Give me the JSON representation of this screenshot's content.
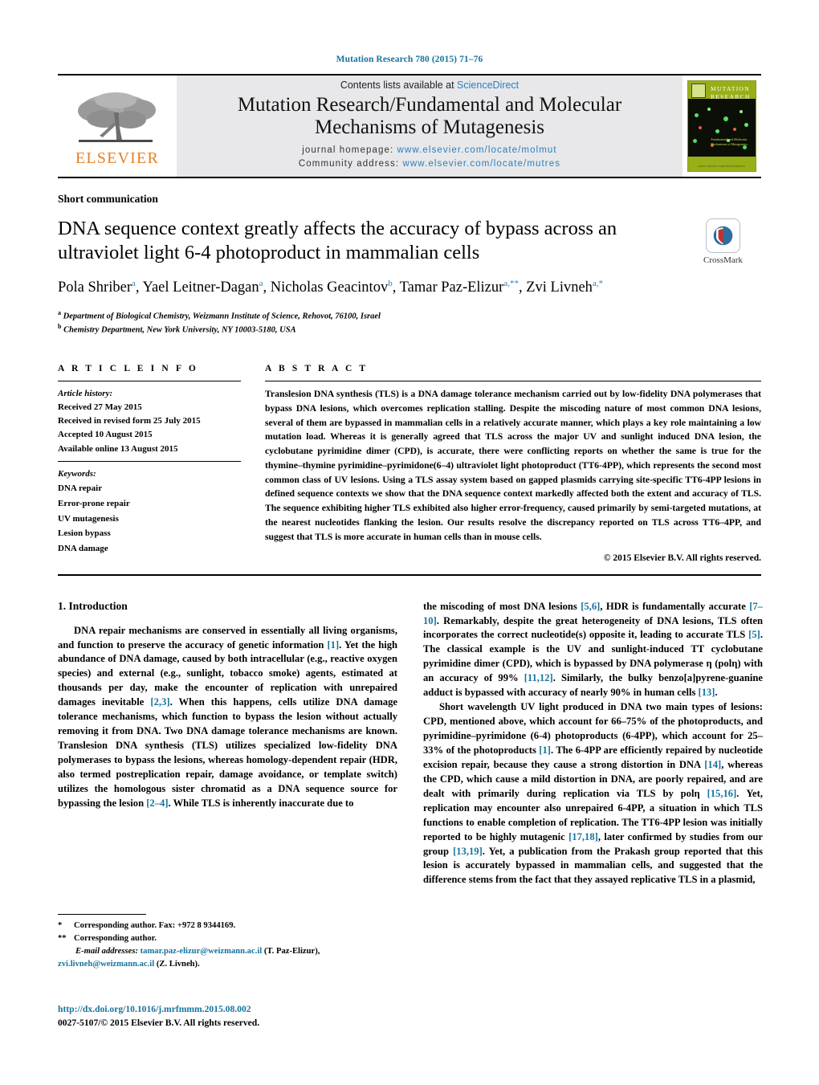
{
  "running_head": "Mutation Research 780 (2015) 71–76",
  "masthead": {
    "publisher_name": "ELSEVIER",
    "contents_prefix": "Contents lists available at ",
    "contents_link": "ScienceDirect",
    "journal_title_line1": "Mutation Research/Fundamental and Molecular",
    "journal_title_line2": "Mechanisms of Mutagenesis",
    "homepage_label": "journal homepage: ",
    "homepage_url": "www.elsevier.com/locate/molmut",
    "community_label": "Community address: ",
    "community_url": "www.elsevier.com/locate/mutres",
    "cover_title_line1": "MUTATION",
    "cover_title_line2": "RESEARCH",
    "cover_subtitle": "Fundamental and Molecular Mechanisms of Mutagenesis",
    "cover_footer": "www.elsevier.com/locate/mutres"
  },
  "article": {
    "type_label": "Short communication",
    "title_line1": "DNA sequence context greatly affects the accuracy of bypass across an",
    "title_line2": "ultraviolet light 6-4 photoproduct in mammalian cells",
    "crossmark_label": "CrossMark",
    "authors_line1": "Pola Shriber",
    "authors_marks": [
      {
        "name": "Pola Shriber",
        "sup": "a",
        "sep": ", "
      },
      {
        "name": "Yael Leitner-Dagan",
        "sup": "a",
        "sep": ", "
      },
      {
        "name": "Nicholas Geacintov",
        "sup": "b",
        "sep": ", "
      },
      {
        "name": "Tamar Paz-Elizur",
        "sup": "a,**",
        "sep": ","
      },
      {
        "name": "Zvi Livneh",
        "sup": "a,*",
        "sep": ""
      }
    ],
    "affiliations": [
      {
        "mark": "a",
        "text": "Department of Biological Chemistry, Weizmann Institute of Science, Rehovot, 76100, Israel"
      },
      {
        "mark": "b",
        "text": "Chemistry Department, New York University, NY 10003-5180, USA"
      }
    ]
  },
  "article_info": {
    "heading": "A R T I C L E    I N F O",
    "history_label": "Article history:",
    "history": [
      "Received 27 May 2015",
      "Received in revised form 25 July 2015",
      "Accepted 10 August 2015",
      "Available online 13 August 2015"
    ],
    "keywords_label": "Keywords:",
    "keywords": [
      "DNA repair",
      "Error-prone repair",
      "UV mutagenesis",
      "Lesion bypass",
      "DNA damage"
    ]
  },
  "abstract": {
    "heading": "A B S T R A C T",
    "text": "Translesion DNA synthesis (TLS) is a DNA damage tolerance mechanism carried out by low-fidelity DNA polymerases that bypass DNA lesions, which overcomes replication stalling. Despite the miscoding nature of most common DNA lesions, several of them are bypassed in mammalian cells in a relatively accurate manner, which plays a key role maintaining a low mutation load. Whereas it is generally agreed that TLS across the major UV and sunlight induced DNA lesion, the cyclobutane pyrimidine dimer (CPD), is accurate, there were conflicting reports on whether the same is true for the thymine–thymine pyrimidine–pyrimidone(6–4) ultraviolet light photoproduct (TT6-4PP), which represents the second most common class of UV lesions. Using a TLS assay system based on gapped plasmids carrying site-specific TT6-4PP lesions in defined sequence contexts we show that the DNA sequence context markedly affected both the extent and accuracy of TLS. The sequence exhibiting higher TLS exhibited also higher error-frequency, caused primarily by semi-targeted mutations, at the nearest nucleotides flanking the lesion. Our results resolve the discrepancy reported on TLS across TT6–4PP, and suggest that TLS is more accurate in human cells than in mouse cells.",
    "copyright": "© 2015 Elsevier B.V. All rights reserved."
  },
  "introduction": {
    "heading": "1.  Introduction",
    "left_paragraph_1_a": "DNA repair mechanisms are conserved in essentially all living organisms, and function to preserve the accuracy of genetic information ",
    "left_ref_1": "[1]",
    "left_paragraph_1_b": ". Yet the high abundance of DNA damage, caused by both intracellular (e.g., reactive oxygen species) and external (e.g., sunlight, tobacco smoke) agents, estimated at thousands per day, make the encounter of replication with unrepaired damages inevitable ",
    "left_ref_2": "[2,3]",
    "left_paragraph_1_c": ". When this happens, cells utilize DNA damage tolerance mechanisms, which function to bypass the lesion without actually removing it from DNA. Two DNA damage tolerance mechanisms are known. Translesion DNA synthesis (TLS) utilizes specialized low-fidelity DNA polymerases to bypass the lesions, whereas homology-dependent repair (HDR, also termed postreplication repair, damage avoidance, or template switch) utilizes the homologous sister chromatid as a DNA sequence source for bypassing the lesion ",
    "left_ref_3": "[2–4]",
    "left_paragraph_1_d": ". While TLS is inherently inaccurate due to",
    "right_cont_a": "the miscoding of most DNA lesions ",
    "right_ref_56": "[5,6]",
    "right_cont_b": ", HDR is fundamentally accurate ",
    "right_ref_710": "[7–10]",
    "right_cont_c": ". Remarkably, despite the great heterogeneity of DNA lesions, TLS often incorporates the correct nucleotide(s) opposite it, leading to accurate TLS ",
    "right_ref_5": "[5]",
    "right_cont_d": ". The classical example is the UV and sunlight-induced TT cyclobutane pyrimidine dimer (CPD), which is bypassed by DNA polymerase η (polη) with an accuracy of 99% ",
    "right_ref_1112": "[11,12]",
    "right_cont_e": ". Similarly, the bulky benzo[a]pyrene-guanine adduct is bypassed with accuracy of nearly 90% in human cells ",
    "right_ref_13": "[13]",
    "right_cont_f": ".",
    "right_p2_a": "Short wavelength UV light produced in DNA two main types of lesions: CPD, mentioned above, which account for 66–75% of the photoproducts, and pyrimidine–pyrimidone (6-4) photoproducts (6-4PP), which account for 25–33% of the photoproducts ",
    "right_p2_ref1": "[1]",
    "right_p2_b": ". The 6-4PP are efficiently repaired by nucleotide excision repair, because they cause a strong distortion in DNA ",
    "right_p2_ref14": "[14]",
    "right_p2_c": ", whereas the CPD, which cause a mild distortion in DNA, are poorly repaired, and are dealt with primarily during replication via TLS by polη ",
    "right_p2_ref1516": "[15,16]",
    "right_p2_d": ". Yet, replication may encounter also unrepaired 6-4PP, a situation in which TLS functions to enable completion of replication. The TT6-4PP lesion was initially reported to be highly mutagenic ",
    "right_p2_ref1718": "[17,18]",
    "right_p2_e": ", later confirmed by studies from our group ",
    "right_p2_ref1319": "[13,19]",
    "right_p2_f": ". Yet, a publication from the Prakash group reported that this lesion is accurately bypassed in mammalian cells, and suggested that the difference stems from the fact that they assayed replicative TLS in a plasmid,"
  },
  "footnotes": {
    "star1_mark": "*",
    "star1_text": "Corresponding author. Fax: +972 8 9344169.",
    "star2_mark": "**",
    "star2_text": "Corresponding author.",
    "email_label": "E-mail addresses:",
    "email1": "tamar.paz-elizur@weizmann.ac.il",
    "email1_owner": "(T. Paz-Elizur),",
    "email2": "zvi.livneh@weizmann.ac.il",
    "email2_owner": "(Z. Livneh).",
    "doi": "http://dx.doi.org/10.1016/j.mrfmmm.2015.08.002",
    "issn_line": "0027-5107/© 2015 Elsevier B.V. All rights reserved."
  },
  "colors": {
    "link_blue": "#16739e",
    "sd_blue": "#2a7fbd",
    "elsevier_orange": "#e87f20",
    "masthead_gray": "#e8e8ea"
  }
}
